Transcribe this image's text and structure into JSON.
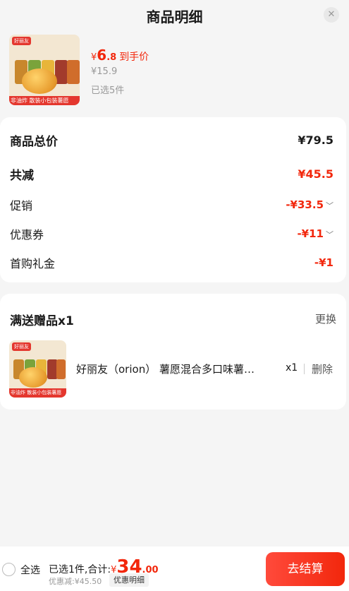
{
  "header": {
    "title": "商品明细"
  },
  "product": {
    "thumb_tag": "好丽友",
    "thumb_banner": "非油炸 散装小包装薯愿",
    "price_currency": "¥",
    "price_int": "6",
    "price_dec": ".8",
    "price_label": "到手价",
    "original_price": "¥15.9",
    "selected_count": "已选5件"
  },
  "summary": {
    "total_label": "商品总价",
    "total_value": "¥79.5",
    "reduce_label": "共减",
    "reduce_value": "¥45.5",
    "promo_label": "促销",
    "promo_value": "-¥33.5",
    "coupon_label": "优惠券",
    "coupon_value": "-¥11",
    "gift_money_label": "首购礼金",
    "gift_money_value": "-¥1"
  },
  "gift": {
    "title": "满送赠品x1",
    "change": "更换",
    "thumb_tag": "好丽友",
    "thumb_banner": "非油炸 散装小包装薯愿",
    "name": "好丽友（orion） 薯愿混合多口味薯…",
    "qty": "x1",
    "delete": "删除"
  },
  "bottom": {
    "select_all": "全选",
    "summary_prefix": "已选1件,合计:",
    "total_currency": "¥",
    "total_int": "34",
    "total_dec": ".00",
    "discount_text": "优惠减:¥45.50",
    "detail_button": "优惠明细",
    "checkout": "去结算"
  },
  "colors": {
    "accent": "#f2270c",
    "background": "#f5f5f5"
  }
}
